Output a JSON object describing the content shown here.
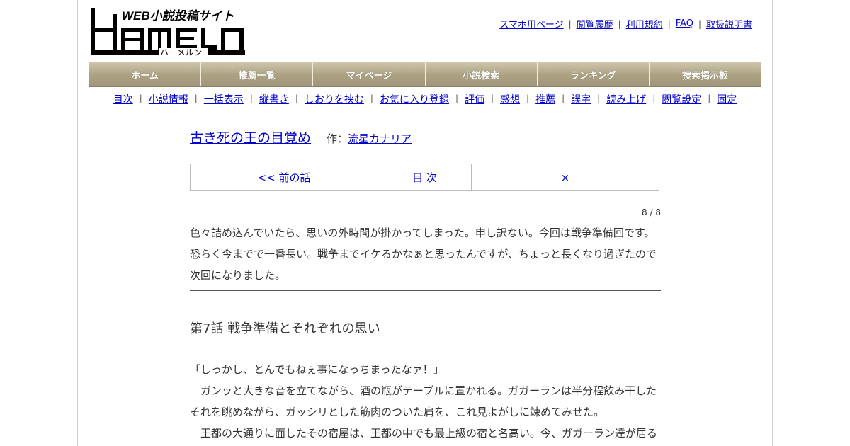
{
  "logo": {
    "tagline": "WEB小説投稿サイト",
    "wordmark": "HAMELN",
    "kana": "ハーメルン"
  },
  "header_links": [
    "スマホ用ページ",
    "閲覧履歴",
    "利用規約",
    "FAQ",
    "取扱説明書"
  ],
  "main_nav": [
    "ホーム",
    "推薦一覧",
    "マイページ",
    "小説検索",
    "ランキング",
    "捜索掲示板"
  ],
  "sub_nav": [
    "目次",
    "小説情報",
    "一括表示",
    "縦書き",
    "しおりを挟む",
    "お気に入り登録",
    "評価",
    "感想",
    "推薦",
    "誤字",
    "読み上げ",
    "閲覧設定",
    "固定"
  ],
  "novel": {
    "title": "古き死の王の目覚め",
    "author_prefix": "作：",
    "author": "流星カナリア"
  },
  "chapter_nav": {
    "prev": "<< 前の話",
    "toc": "目 次",
    "next": "×"
  },
  "page_count": "8 / 8",
  "preface": [
    "色々詰め込んでいたら、思いの外時間が掛かってしまった。申し訳ない。今回は戦争準備回です。",
    "恐らく今までで一番長い。戦争までイケるかなぁと思ったんですが、ちょっと長くなり過ぎたので",
    "次回になりました。"
  ],
  "chapter_title": "第7話 戦争準備とそれぞれの思い",
  "body": [
    "「しっかし、とんでもねぇ事になっちまったなァ！」",
    "　ガンッと大きな音を立てながら、酒の瓶がテーブルに置かれる。ガガーランは半分程飲み干した",
    "それを眺めながら、ガッシリとした筋肉のついた肩を、これ見よがしに竦めてみせた。",
    "　王都の大通りに面したその宿屋は、王都の中でも最上級の宿と名高い。今、ガガーラン達が居る"
  ]
}
